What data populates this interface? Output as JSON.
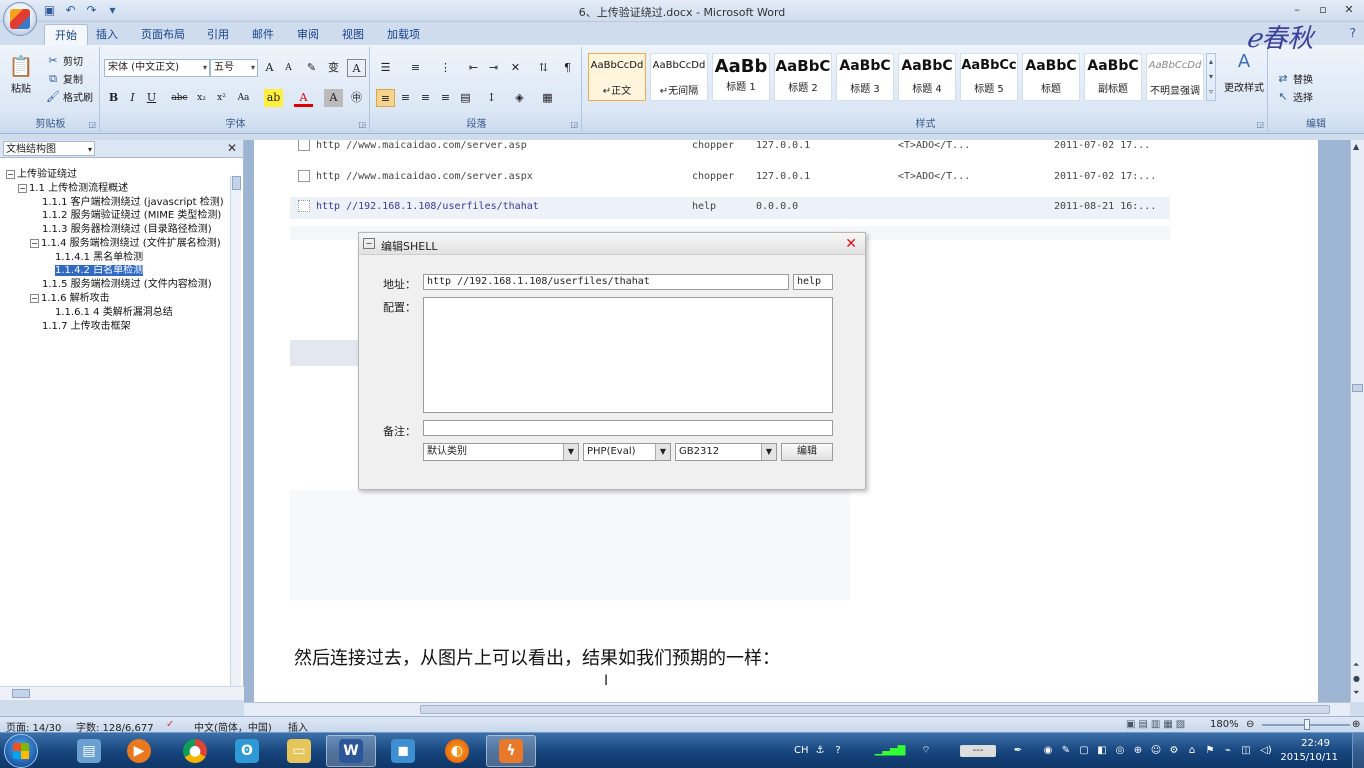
{
  "window": {
    "title": "6、上传验证绕过.docx - Microsoft Word",
    "controls": [
      "–",
      "▫",
      "✕"
    ]
  },
  "qat": [
    "save-icon",
    "undo-icon",
    "redo-icon"
  ],
  "tabs": [
    "开始",
    "插入",
    "页面布局",
    "引用",
    "邮件",
    "审阅",
    "视图",
    "加载项"
  ],
  "ribbon": {
    "clipboard": {
      "label": "剪贴板",
      "paste": "粘贴",
      "cut": "剪切",
      "copy": "复制",
      "format_painter": "格式刷"
    },
    "font": {
      "label": "字体",
      "font_name": "宋体 (中文正文)",
      "font_size": "五号"
    },
    "paragraph": {
      "label": "段落"
    },
    "styles": {
      "label": "样式",
      "items": [
        {
          "sample": "AaBbCcDd",
          "name": "↵正文"
        },
        {
          "sample": "AaBbCcDd",
          "name": "↵无间隔"
        },
        {
          "sample": "AaBb",
          "name": "标题 1"
        },
        {
          "sample": "AaBbC",
          "name": "标题 2"
        },
        {
          "sample": "AaBbC",
          "name": "标题 3"
        },
        {
          "sample": "AaBbC",
          "name": "标题 4"
        },
        {
          "sample": "AaBbCc",
          "name": "标题 5"
        },
        {
          "sample": "AaBbC",
          "name": "标题"
        },
        {
          "sample": "AaBbC",
          "name": "副标题"
        },
        {
          "sample": "AaBbCcDd",
          "name": "不明显强调"
        }
      ],
      "change_styles": "更改样式"
    },
    "editing": {
      "label": "编辑",
      "replace": "替换",
      "select": "选择"
    }
  },
  "docmap": {
    "mode": "文档结构图",
    "items": [
      {
        "text": "上传验证绕过",
        "toggle": "⊟"
      },
      {
        "text": "1.1 上传检测流程概述",
        "toggle": "⊟"
      },
      {
        "text": "1.1.1 客户端检测绕过 (javascript 检测)",
        "toggle": ""
      },
      {
        "text": "1.1.2 服务端验证绕过 (MIME 类型检测)",
        "toggle": ""
      },
      {
        "text": "1.1.3 服务器检测绕过 (目录路径检测)",
        "toggle": ""
      },
      {
        "text": "1.1.4 服务端检测绕过 (文件扩展名检测)",
        "toggle": "⊟"
      },
      {
        "text": "1.1.4.1 黑名单检测",
        "toggle": ""
      },
      {
        "text": "1.1.4.2 白名单检测",
        "toggle": "",
        "selected": true
      },
      {
        "text": "1.1.5 服务端检测绕过 (文件内容检测)",
        "toggle": ""
      },
      {
        "text": "1.1.6 解析攻击",
        "toggle": "⊟"
      },
      {
        "text": "1.1.6.1 4 类解析漏洞总结",
        "toggle": ""
      },
      {
        "text": "1.1.7 上传攻击框架",
        "toggle": ""
      }
    ]
  },
  "document": {
    "shell_rows": [
      {
        "url": "http //www.maicaidao.com/server.asp",
        "pass": "chopper",
        "ip": "127.0.0.1",
        "os": "<T>ADO</T...",
        "time": "2011-07-02 17..."
      },
      {
        "url": "http //www.maicaidao.com/server.aspx",
        "pass": "chopper",
        "ip": "127.0.0.1",
        "os": "<T>ADO</T...",
        "time": "2011-07-02 17:..."
      },
      {
        "url": "http //192.168.1.108/userfiles/thahat",
        "pass": "help",
        "ip": "0.0.0.0",
        "os": "",
        "time": "2011-08-21 16:..."
      }
    ],
    "dialog": {
      "title": "编辑SHELL",
      "address_label": "地址：",
      "address_value": "http //192.168.1.108/userfiles/thahat",
      "password_value": "help",
      "config_label": "配置：",
      "note_label": "备注：",
      "category": "默认类别",
      "script_type": "PHP(Eval)",
      "encoding": "GB2312",
      "edit_button": "编辑"
    },
    "body_text": "然后连接过去，从图片上可以看出，结果如我们预期的一样："
  },
  "status": {
    "page": "页面: 14/30",
    "words": "字数: 128/6,677",
    "language": "中文(简体，中国)",
    "mode": "插入",
    "zoom": "180%"
  },
  "taskbar": {
    "apps": [
      "explorer-icon",
      "media-player-icon",
      "chrome-icon",
      "messenger-icon",
      "folder-icon",
      "word-icon",
      "blue-app-icon",
      "firefox-icon",
      "orange-app-icon"
    ],
    "time": "22:49",
    "date": "2015/10/11"
  }
}
